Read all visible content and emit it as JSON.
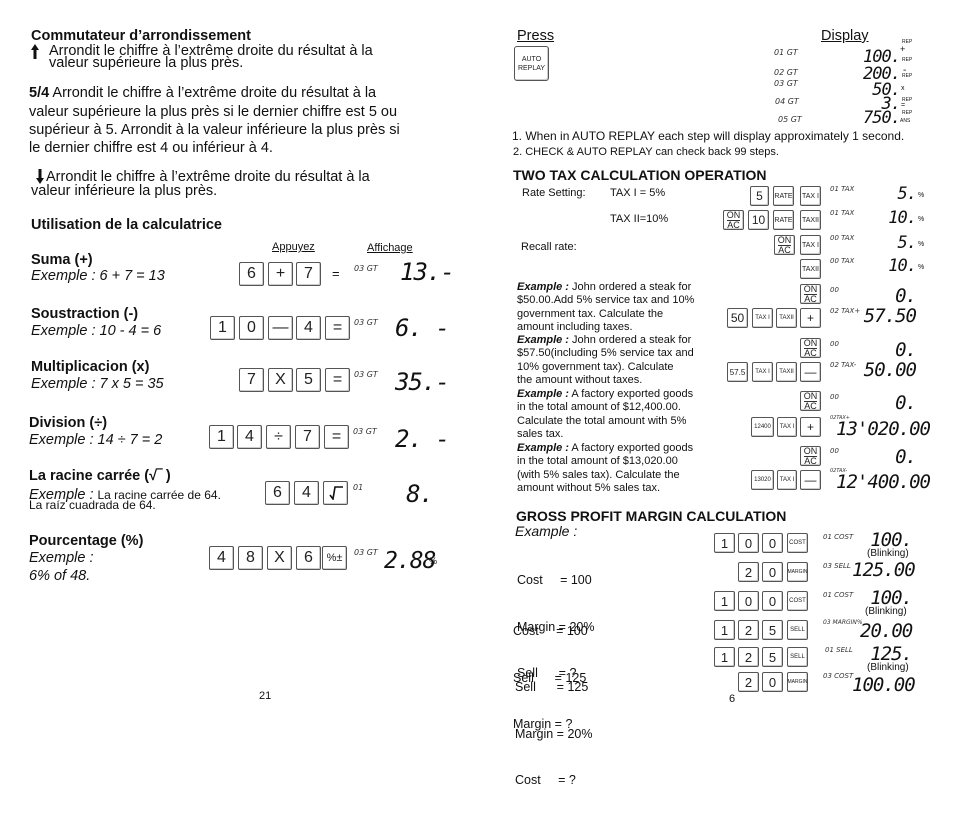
{
  "left_page": {
    "rounding_switch": {
      "title": "Commutateur d’arrondissement",
      "up_icon": "arrow-up-icon",
      "up_text_line1": "Arrondit  le  chiffre  à  l’extrême  droite  du  résultat à la",
      "up_text_line2": "valeur supérieure la plus près.",
      "five_four_label": "5/4",
      "five_four_line1": " Arrondit  le  chiffre  à  l’extrême  droite  du  résultat à la",
      "five_four_line2": "valeur supérieure  la  plus près si le dernier chiffre est 5  ou",
      "five_four_line3": "supérieur  à  5. Arrondit à la valeur inférieure la plus près si",
      "five_four_line4": "le dernier chiffre est 4 ou inférieur à 4.",
      "down_icon": "arrow-down-icon",
      "down_text_line1": " Arrondit  le  chiffre  à  l’extrême  droite  du  résultat à la",
      "down_text_line2": "valeur inférieure la plus près."
    },
    "usage_title": "Utilisation de la calculatrice",
    "col_press": "Appuyez",
    "col_display": "Affichage",
    "examples": [
      {
        "title": "Suma (+)",
        "example": "Exemple : 6 + 7 = 13",
        "keys": [
          "6",
          "+",
          "7"
        ],
        "equals_plain": "=",
        "indicator": "03 GT",
        "display": "13.-"
      },
      {
        "title": "Soustraction (-)",
        "example": "Exemple : 10 - 4 = 6",
        "keys": [
          "1",
          "0",
          "—",
          "4",
          "="
        ],
        "indicator": "03 GT",
        "display": "6. -"
      },
      {
        "title": "Multiplicacion (x)",
        "example": "Exemple : 7 x 5 = 35",
        "keys": [
          "7",
          "X",
          "5",
          "="
        ],
        "indicator": "03 GT",
        "display": "35.-"
      },
      {
        "title": "Division (÷)",
        "example": "Exemple : 14 ÷ 7 = 2",
        "keys": [
          "1",
          "4",
          "÷",
          "7",
          "="
        ],
        "indicator": "03 GT",
        "display": "2. -"
      },
      {
        "title": "La racine carrée (√‾ )",
        "example_label": "Exemple : ",
        "example_rest": "La racine carrée de 64.",
        "example_line2": "La raíz cuadrada de 64.",
        "keys": [
          "6",
          "4",
          "√‾"
        ],
        "indicator": "01",
        "display": "8."
      },
      {
        "title": "Pourcentage (%)",
        "example": "Exemple :",
        "example_line2": "6% of 48.",
        "keys": [
          "4",
          "8",
          "X",
          "6",
          "%±"
        ],
        "indicator": "03 GT",
        "display": "2.88",
        "display_suffix": "%"
      }
    ],
    "page_number": "21"
  },
  "right_page": {
    "replay": {
      "col_press": "Press",
      "col_display": "Display",
      "key_line1": "AUTO",
      "key_line2": "REPLAY",
      "steps": [
        {
          "indicator": "01 GT",
          "value": "100.",
          "op": "+",
          "tag": "REP"
        },
        {
          "indicator": "02 GT",
          "value": "200.",
          "op": "-",
          "tag": "REP"
        },
        {
          "indicator": "03 GT",
          "value": "50.",
          "op": "x",
          "tag": "REP"
        },
        {
          "indicator": "04 GT",
          "value": "3.",
          "op": "=",
          "tag": "REP"
        },
        {
          "indicator": "05 GT",
          "value": "750.",
          "op": "ANS",
          "tag": "REP"
        }
      ],
      "note1": "1. When in AUTO REPLAY each step will display approximately 1 second.",
      "note2": "2. CHECK & AUTO REPLAY can check back 99 steps."
    },
    "tax": {
      "title": "TWO TAX CALCULATION OPERATION",
      "rate_setting_label": "Rate Setting:",
      "tax1_label": "TAX I = 5%",
      "tax2_label": "TAX II=10%",
      "recall_label": "Recall rate:",
      "rows": [
        {
          "keys": [
            "5",
            "RATE",
            "TAX I"
          ],
          "indicator": "01 TAX",
          "display": "5.",
          "suffix": "%"
        },
        {
          "keys": [
            "ON/AC",
            "10",
            "RATE",
            "TAXII"
          ],
          "indicator": "01 TAX",
          "display": "10.",
          "suffix": "%"
        },
        {
          "keys": [
            "ON/AC",
            "TAX I"
          ],
          "indicator": "00 TAX",
          "display": "5.",
          "suffix": "%"
        },
        {
          "keys": [
            "TAXII"
          ],
          "indicator": "00 TAX",
          "display": "10.",
          "suffix": "%"
        },
        {
          "keys": [
            "ON/AC"
          ],
          "indicator": "00",
          "display": "0."
        },
        {
          "keys": [
            "50",
            "TAX I",
            "TAXII",
            "+"
          ],
          "indicator": "02 TAX+",
          "display": "57.50"
        },
        {
          "keys": [
            "ON/AC"
          ],
          "indicator": "00",
          "display": "0."
        },
        {
          "keys": [
            "57.5",
            "TAX I",
            "TAXII",
            "—"
          ],
          "indicator": "02 TAX-",
          "display": "50.00"
        },
        {
          "keys": [
            "ON/AC"
          ],
          "indicator": "00",
          "display": "0."
        },
        {
          "keys": [
            "12400",
            "TAX I",
            "+"
          ],
          "indicator": "02TAX+",
          "display": "13'020.00"
        },
        {
          "keys": [
            "ON/AC"
          ],
          "indicator": "00",
          "display": "0."
        },
        {
          "keys": [
            "13020",
            "TAX I",
            "—"
          ],
          "indicator": "02TAX-",
          "display": "12'400.00"
        }
      ],
      "on_label": "ON",
      "ac_label": "AC",
      "examples": [
        {
          "label": "Example :",
          "lines": [
            " John ordered a steak for",
            "$50.00.Add 5% service tax and 10%",
            "government tax. Calculate the",
            "amount including taxes."
          ]
        },
        {
          "label": "Example :",
          "lines": [
            " John ordered a steak for",
            "$57.50(including 5% service tax and",
            "10% government tax). Calculate",
            "the amount without taxes."
          ]
        },
        {
          "label": "Example :",
          "lines": [
            " A factory exported goods",
            "in the total amount of $12,400.00.",
            "Calculate the total amount with 5%",
            "sales tax."
          ]
        },
        {
          "label": "Example :",
          "lines": [
            " A factory exported goods",
            "in the total amount of $13,020.00",
            "(with 5% sales tax). Calculate the",
            "amount without 5% sales tax."
          ]
        }
      ]
    },
    "margin": {
      "title": "GROSS PROFIT MARGIN CALCULATION",
      "example_label": "Example :",
      "case1": [
        "Cost     = 100",
        "Margin = 20%",
        "Sell      = ?"
      ],
      "case2": [
        "Cost     = 100",
        "Sell      = 125",
        "Margin = ?"
      ],
      "case3": [
        "Sell      = 125",
        "Margin = 20%",
        "Cost     = ?"
      ],
      "rows": [
        {
          "keys": [
            "1",
            "0",
            "0",
            "COST"
          ],
          "indicator": "01 COST",
          "display": "100.",
          "note": "(Blinking)"
        },
        {
          "keys": [
            "2",
            "0",
            "MARGIN"
          ],
          "indicator": "03 SELL",
          "display": "125.00"
        },
        {
          "keys": [
            "1",
            "0",
            "0",
            "COST"
          ],
          "indicator": "01 COST",
          "display": "100.",
          "note": "(Blinking)"
        },
        {
          "keys": [
            "1",
            "2",
            "5",
            "SELL"
          ],
          "indicator": "03 MARGIN%",
          "display": "20.00"
        },
        {
          "keys": [
            "1",
            "2",
            "5",
            "SELL"
          ],
          "indicator": "01 SELL",
          "display": "125.",
          "note": "(Blinking)"
        },
        {
          "keys": [
            "2",
            "0",
            "MARGIN"
          ],
          "indicator": "03 COST",
          "display": "100.00"
        }
      ]
    },
    "page_number": "6"
  }
}
